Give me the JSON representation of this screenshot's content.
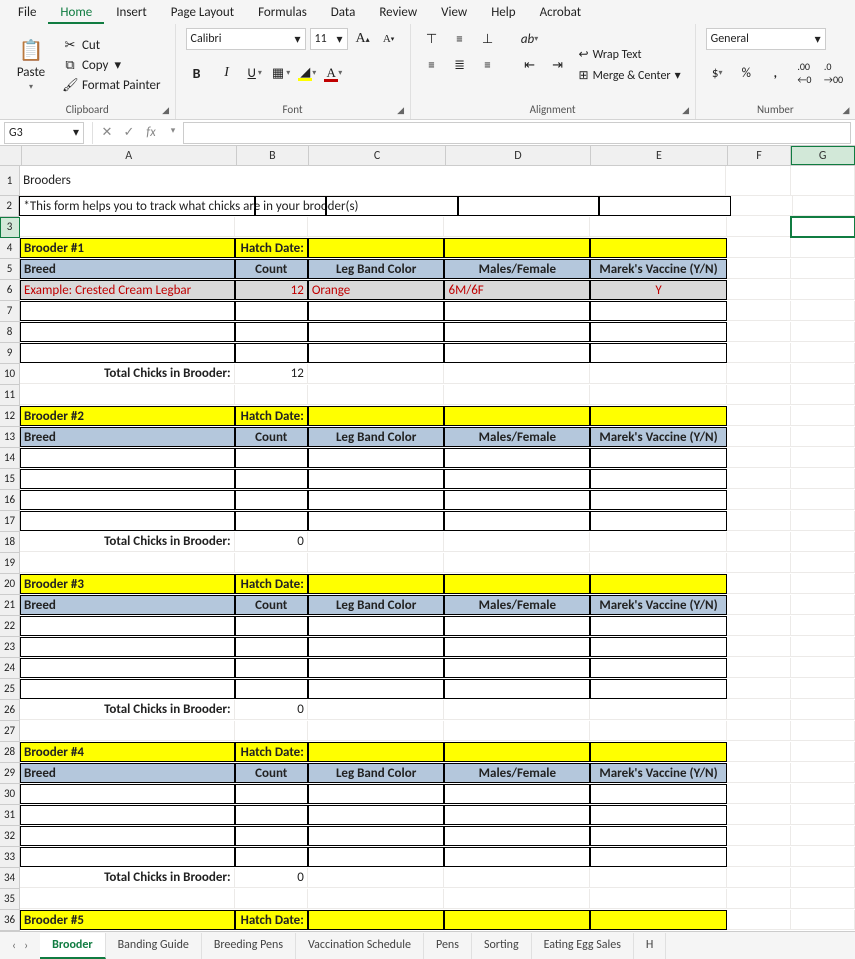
{
  "menus": {
    "file": "File",
    "home": "Home",
    "insert": "Insert",
    "page": "Page Layout",
    "formulas": "Formulas",
    "data": "Data",
    "review": "Review",
    "view": "View",
    "help": "Help",
    "acrobat": "Acrobat"
  },
  "clipboard": {
    "paste": "Paste",
    "cut": "Cut",
    "copy": "Copy",
    "painter": "Format Painter",
    "label": "Clipboard"
  },
  "font": {
    "name": "Calibri",
    "size": "11",
    "label": "Font"
  },
  "align": {
    "wrap": "Wrap Text",
    "merge": "Merge & Center",
    "label": "Alignment"
  },
  "number": {
    "format": "General",
    "label": "Number"
  },
  "namebox": "G3",
  "colheads": {
    "A": "A",
    "B": "B",
    "C": "C",
    "D": "D",
    "E": "E",
    "F": "F",
    "G": "G"
  },
  "title": "Brooders",
  "note": "*This form helps you to track what chicks are in your brooder(s)",
  "lbl": {
    "hatch": "Hatch Date:",
    "breed": "Breed",
    "count": "Count",
    "leg": "Leg Band Color",
    "mf": "Males/Female",
    "marek": "Marek's Vaccine (Y/N)",
    "total": "Total Chicks in Brooder:"
  },
  "brooders": {
    "b1": {
      "name": "Brooder #1",
      "total": "12"
    },
    "b2": {
      "name": "Brooder #2",
      "total": "0"
    },
    "b3": {
      "name": "Brooder #3",
      "total": "0"
    },
    "b4": {
      "name": "Brooder #4",
      "total": "0"
    },
    "b5": {
      "name": "Brooder #5"
    }
  },
  "example": {
    "breed": "Example: Crested Cream Legbar",
    "count": "12",
    "leg": "Orange",
    "mf": "6M/6F",
    "marek": "Y"
  },
  "tabs": {
    "brooder": "Brooder",
    "banding": "Banding Guide",
    "breeding": "Breeding Pens",
    "vacc": "Vaccination Schedule",
    "pens": "Pens",
    "sort": "Sorting",
    "egg": "Eating Egg Sales",
    "more": "H"
  }
}
